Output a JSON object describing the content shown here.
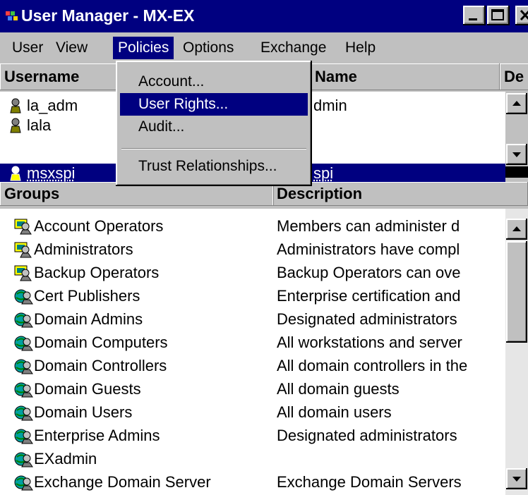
{
  "window": {
    "title": "User Manager - MX-EX"
  },
  "menu": [
    "User",
    "View",
    "Policies",
    "Options",
    "Exchange",
    "Help"
  ],
  "active_menu": "Policies",
  "policies_menu": {
    "items": [
      "Account...",
      "User Rights...",
      "Audit...",
      "Trust Relationships..."
    ],
    "highlighted": "User Rights..."
  },
  "users": {
    "columns": [
      "Username",
      "Name",
      "De"
    ],
    "rows": [
      {
        "username": "la_adm",
        "name": "dmin"
      },
      {
        "username": "lala",
        "name": ""
      },
      {
        "username": "msxspi",
        "name": "spi",
        "selected": true
      }
    ]
  },
  "groups": {
    "columns": [
      "Groups",
      "Description"
    ],
    "rows": [
      {
        "name": "Account Operators",
        "description": "Members can administer d"
      },
      {
        "name": "Administrators",
        "description": "Administrators have compl"
      },
      {
        "name": "Backup Operators",
        "description": "Backup Operators can ove"
      },
      {
        "name": "Cert Publishers",
        "description": "Enterprise certification and"
      },
      {
        "name": "Domain Admins",
        "description": "Designated administrators"
      },
      {
        "name": "Domain Computers",
        "description": "All workstations and server"
      },
      {
        "name": "Domain Controllers",
        "description": "All domain controllers in the"
      },
      {
        "name": "Domain Guests",
        "description": "All domain guests"
      },
      {
        "name": "Domain Users",
        "description": "All domain users"
      },
      {
        "name": "Enterprise Admins",
        "description": "Designated administrators"
      },
      {
        "name": "EXadmin",
        "description": ""
      },
      {
        "name": "Exchange Domain Server",
        "description": "Exchange Domain Servers"
      }
    ]
  },
  "colors": {
    "selection": "#000080",
    "face": "#c0c0c0"
  }
}
